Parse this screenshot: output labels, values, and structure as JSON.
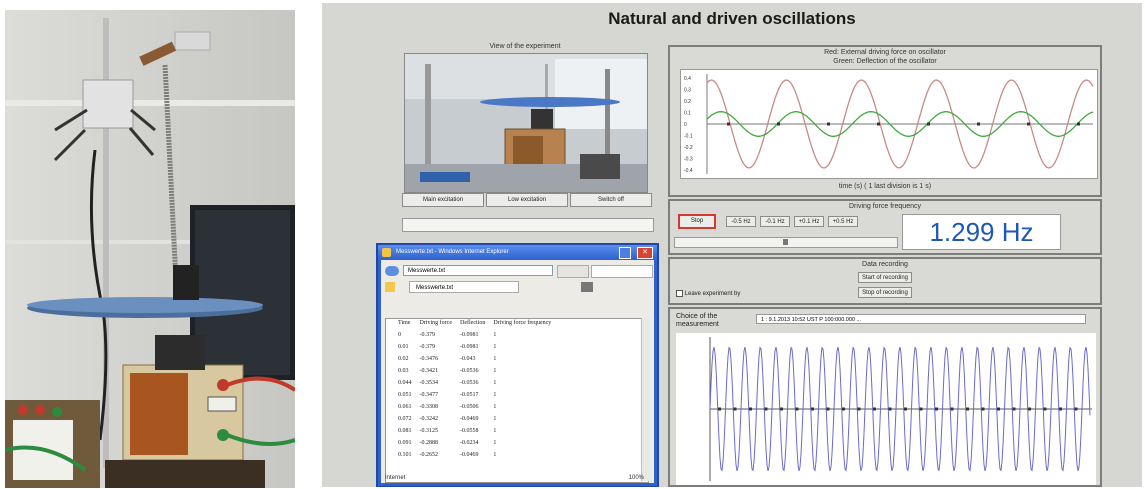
{
  "ui_title": "Natural and driven oscillations",
  "webcam": {
    "caption": "View of the experiment",
    "buttons": [
      "Main excitation",
      "Low excitation",
      "Switch off"
    ]
  },
  "graph_panel": {
    "legend_red": "Red: External driving force on oscillator",
    "legend_green": "Green: Deflection of the oscillator",
    "y_ticks": [
      "0.4",
      "0.3",
      "0.2",
      "0.1",
      "0",
      "-0.1",
      "-0.2",
      "-0.3",
      "-0.4"
    ],
    "x_caption": "time (s) ( 1 last division is 1 s)"
  },
  "driving": {
    "title": "Driving force frequency",
    "stop_label": "Stop",
    "step_buttons": [
      "-0.5 Hz",
      "-0.1 Hz",
      "+0.1 Hz",
      "+0.5 Hz"
    ],
    "frequency_display": "1.299 Hz"
  },
  "data_recording": {
    "title": "Data recording",
    "start_label": "Start of recording",
    "stop_label": "Stop of recording",
    "checkbox_label": "Leave experiment by"
  },
  "measurement": {
    "label": "Choice of the measurement",
    "select_value": "1 : 9.1.2013 10:52 UST    P 100:000.000 ..."
  },
  "ie": {
    "title": "Messwerte.txt - Windows Internet Explorer",
    "address": "Messwerte.txt",
    "tab": "Messwerte.txt",
    "status": "Internet",
    "zoom": "100%",
    "headers": [
      "Time",
      "Driving force",
      "Deflection",
      "Driving force frequency"
    ],
    "rows": [
      [
        "0",
        "-0.379",
        "-0.0981",
        "1"
      ],
      [
        "0.01",
        "-0.379",
        "-0.0981",
        "1"
      ],
      [
        "0.02",
        "-0.3476",
        "-0.043",
        "1"
      ],
      [
        "0.03",
        "-0.3421",
        "-0.0536",
        "1"
      ],
      [
        "0.044",
        "-0.3534",
        "-0.0536",
        "1"
      ],
      [
        "0.051",
        "-0.3477",
        "-0.0517",
        "1"
      ],
      [
        "0.061",
        "-0.3308",
        "-0.0506",
        "1"
      ],
      [
        "0.072",
        "-0.3242",
        "-0.0469",
        "1"
      ],
      [
        "0.081",
        "-0.3125",
        "-0.0558",
        "1"
      ],
      [
        "0.091",
        "-0.2888",
        "-0.0234",
        "1"
      ],
      [
        "0.101",
        "-0.2652",
        "-0.0469",
        "1"
      ]
    ]
  },
  "colors": {
    "driving_curve": "#c98a86",
    "deflection_curve": "#3faa3f",
    "measurement_curve": "#6a6ad0",
    "frequency_text": "#1f57b7"
  }
}
